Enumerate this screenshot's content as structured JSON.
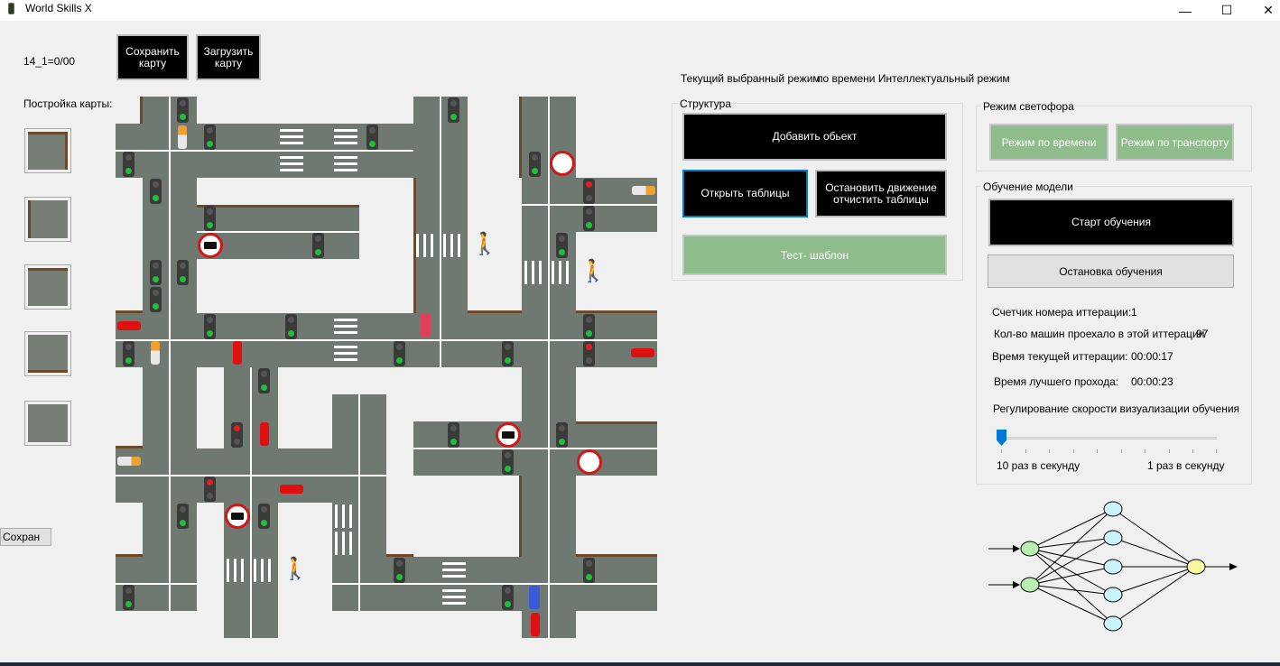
{
  "window": {
    "title": "World Skills X",
    "minimize": "—",
    "maximize": "☐",
    "close": "✕"
  },
  "left": {
    "counter": "14_1=0/00",
    "save_map_btn": "Сохранить карту",
    "load_map_btn": "Загрузить карту",
    "build_label": "Постройка карты:",
    "save_small_btn": "Сохран"
  },
  "mode": {
    "label": "Текущий выбранный режим:",
    "value": "по времени Интеллектуальный режим"
  },
  "structure": {
    "title": "Структура",
    "add_object": "Добавить обьект",
    "open_tables": "Открыть таблицы",
    "stop_clear": "Остановить движение отчистить таблицы",
    "test_template": "Тест- шаблон"
  },
  "traffic_mode": {
    "title": "Режим светофора",
    "by_time": "Режим по времени",
    "by_transport": "Режим по транспорту"
  },
  "training": {
    "title": "Обучение модели",
    "start": "Старт обучения",
    "stop": "Остановка обучения",
    "iteration_label": "Счетчик номера иттерации:",
    "iteration_value": "1",
    "cars_label": "Кол-во машин проехало в этой иттерации",
    "cars_value": "97",
    "cur_time_label": "Время текущей иттерации:",
    "cur_time_value": "00:00:17",
    "best_time_label": "Время лучшего прохода:",
    "best_time_value": "00:00:23",
    "speed_label": "Регулирование скорости визуализации обучения",
    "speed_min": "10 раз в секунду",
    "speed_max": "1 раз в секунду",
    "speed_position": 0
  }
}
